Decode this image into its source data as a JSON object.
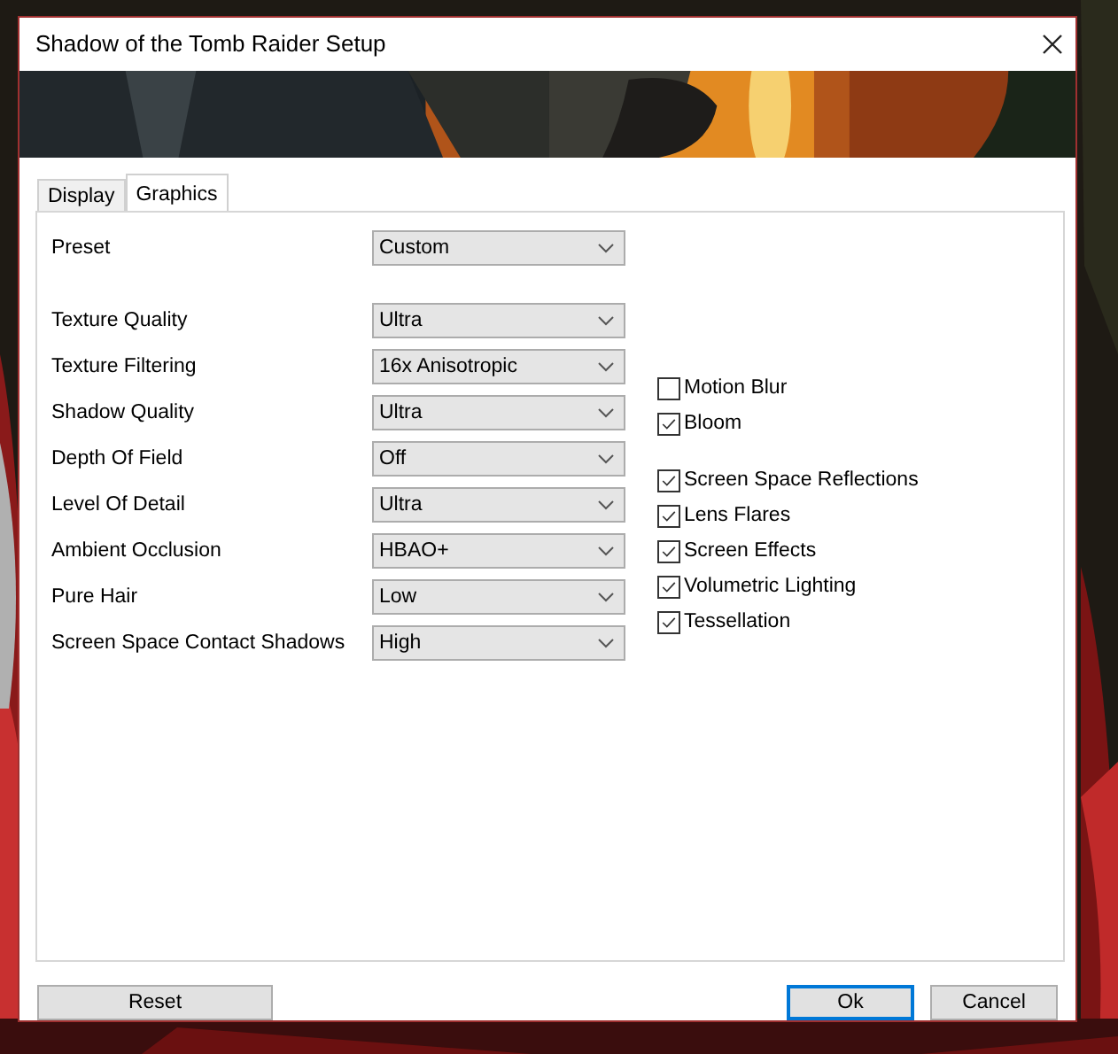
{
  "window": {
    "title": "Shadow of the Tomb Raider Setup"
  },
  "tabs": [
    {
      "label": "Display",
      "selected": false
    },
    {
      "label": "Graphics",
      "selected": true
    }
  ],
  "dropdown_groups": [
    [
      {
        "label": "Preset",
        "value": "Custom"
      }
    ],
    [
      {
        "label": "Texture Quality",
        "value": "Ultra"
      },
      {
        "label": "Texture Filtering",
        "value": "16x Anisotropic"
      },
      {
        "label": "Shadow Quality",
        "value": "Ultra"
      },
      {
        "label": "Depth Of Field",
        "value": "Off"
      },
      {
        "label": "Level Of Detail",
        "value": "Ultra"
      },
      {
        "label": "Ambient Occlusion",
        "value": "HBAO+"
      },
      {
        "label": "Pure Hair",
        "value": "Low"
      },
      {
        "label": "Screen Space Contact Shadows",
        "value": "High"
      }
    ]
  ],
  "checkbox_groups": [
    [
      {
        "label": "Motion Blur",
        "checked": false
      },
      {
        "label": "Bloom",
        "checked": true
      }
    ],
    [
      {
        "label": "Screen Space Reflections",
        "checked": true
      },
      {
        "label": "Lens Flares",
        "checked": true
      },
      {
        "label": "Screen Effects",
        "checked": true
      },
      {
        "label": "Volumetric Lighting",
        "checked": true
      },
      {
        "label": "Tessellation",
        "checked": true
      }
    ]
  ],
  "buttons": [
    {
      "label": "Reset",
      "kind": "left",
      "focused": false
    },
    {
      "label": "Ok",
      "kind": "right",
      "focused": true
    },
    {
      "label": "Cancel",
      "kind": "right",
      "focused": false
    }
  ]
}
